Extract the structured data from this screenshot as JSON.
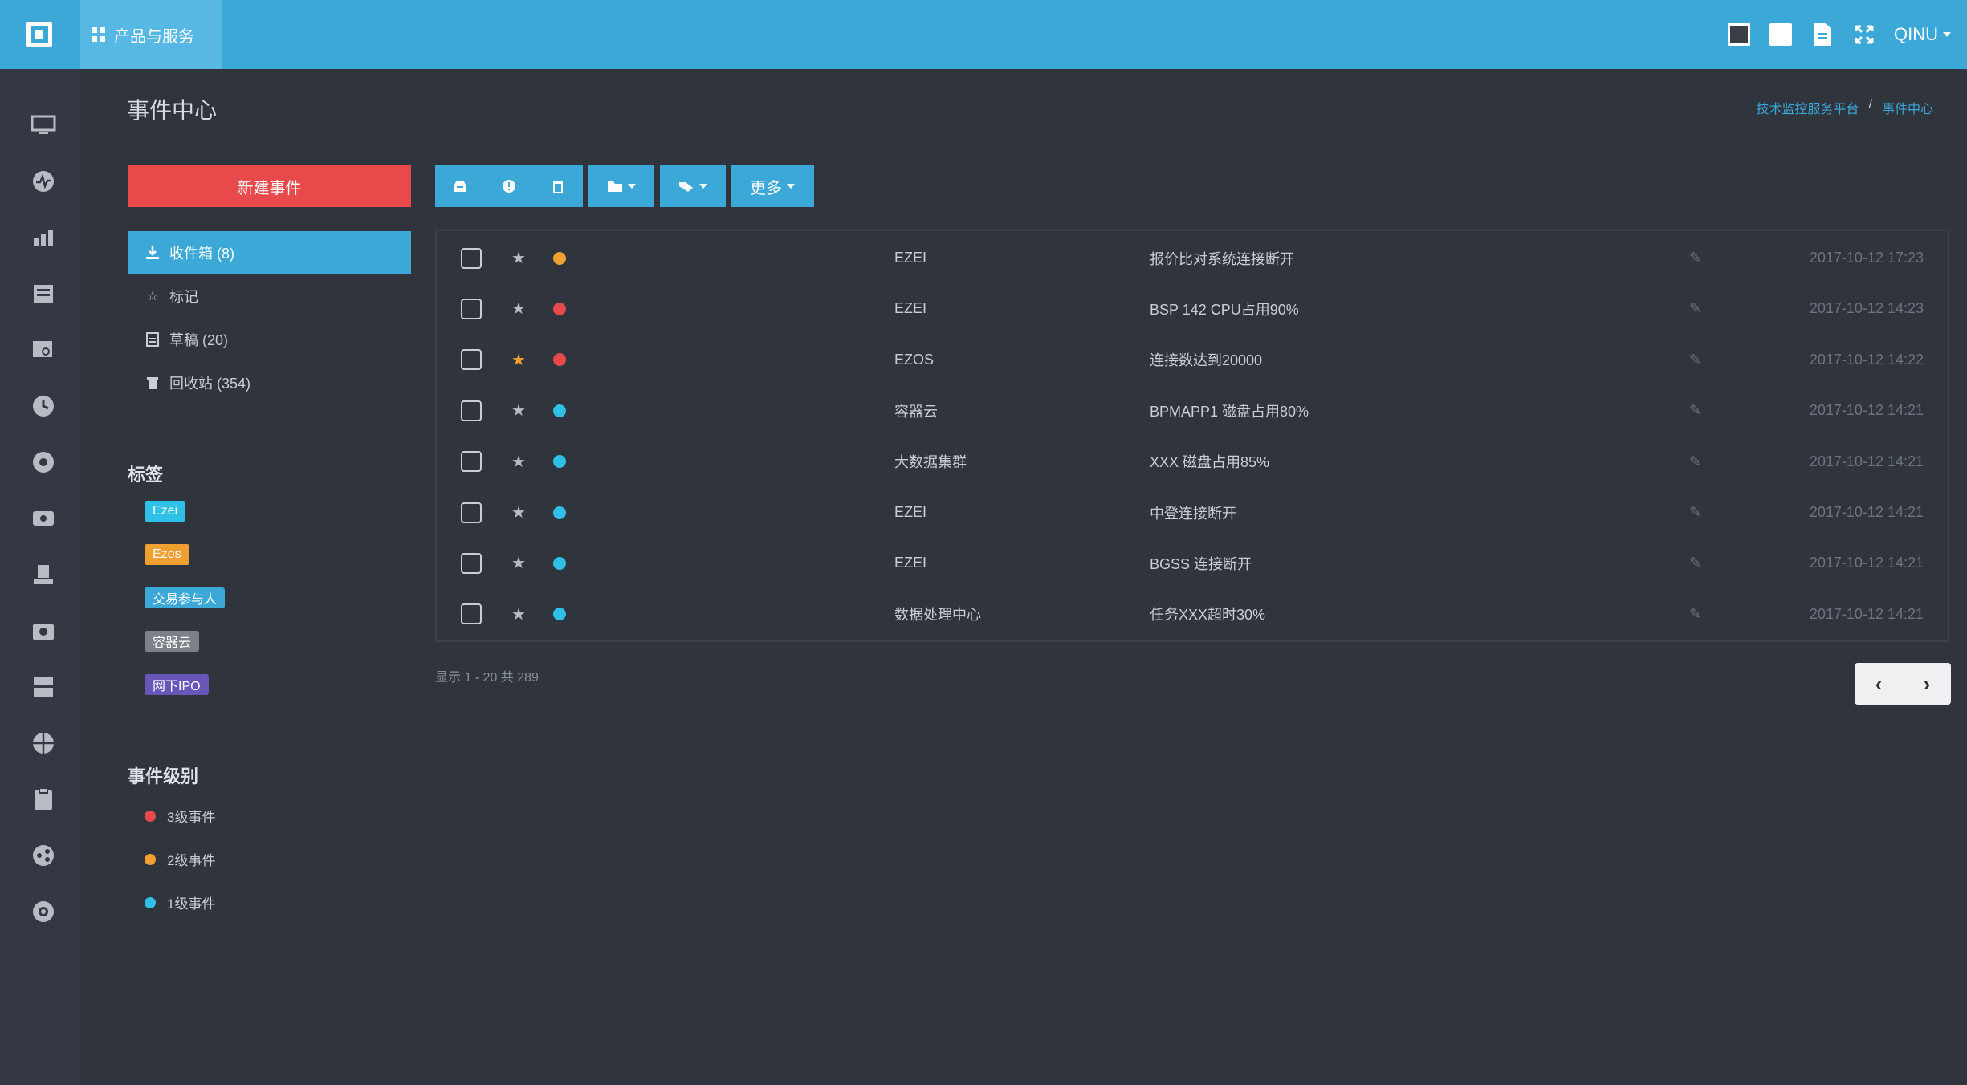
{
  "topbar": {
    "products_label": "产品与服务",
    "user_label": "QINU"
  },
  "page": {
    "title": "事件中心",
    "breadcrumb": [
      "技术监控服务平台",
      "事件中心"
    ]
  },
  "sidebar": {
    "new_event_label": "新建事件",
    "folders": [
      {
        "label": "收件箱 (8)",
        "icon": "inbox-icon",
        "active": true
      },
      {
        "label": "标记",
        "icon": "star-icon",
        "active": false
      },
      {
        "label": "草稿 (20)",
        "icon": "draft-icon",
        "active": false
      },
      {
        "label": "回收站 (354)",
        "icon": "trash-icon",
        "active": false
      }
    ],
    "tags_title": "标签",
    "tags": [
      {
        "label": "Ezei",
        "color": "#2ec0e6"
      },
      {
        "label": "Ezos",
        "color": "#f0a030"
      },
      {
        "label": "交易参与人",
        "color": "#3ba8d8"
      },
      {
        "label": "容器云",
        "color": "#7b8089"
      },
      {
        "label": "网下IPO",
        "color": "#6a55b8"
      }
    ],
    "levels_title": "事件级别",
    "levels": [
      {
        "label": "3级事件",
        "color": "#e8494b"
      },
      {
        "label": "2级事件",
        "color": "#f0a030"
      },
      {
        "label": "1级事件",
        "color": "#2ec0e6"
      }
    ]
  },
  "toolbar": {
    "more_label": "更多"
  },
  "events": [
    {
      "starred": false,
      "severity_color": "#f0a030",
      "source": "EZEI",
      "subject": "报价比对系统连接断开",
      "time": "2017-10-12 17:23"
    },
    {
      "starred": false,
      "severity_color": "#e8494b",
      "source": "EZEI",
      "subject": "BSP 142 CPU占用90%",
      "time": "2017-10-12 14:23"
    },
    {
      "starred": true,
      "severity_color": "#e8494b",
      "source": "EZOS",
      "subject": "连接数达到20000",
      "time": "2017-10-12 14:22"
    },
    {
      "starred": false,
      "severity_color": "#2ec0e6",
      "source": "容器云",
      "subject": "BPMAPP1 磁盘占用80%",
      "time": "2017-10-12 14:21"
    },
    {
      "starred": false,
      "severity_color": "#2ec0e6",
      "source": "大数据集群",
      "subject": "XXX 磁盘占用85%",
      "time": "2017-10-12 14:21"
    },
    {
      "starred": false,
      "severity_color": "#2ec0e6",
      "source": "EZEI",
      "subject": "中登连接断开",
      "time": "2017-10-12 14:21"
    },
    {
      "starred": false,
      "severity_color": "#2ec0e6",
      "source": "EZEI",
      "subject": "BGSS 连接断开",
      "time": "2017-10-12 14:21"
    },
    {
      "starred": false,
      "severity_color": "#2ec0e6",
      "source": "数据处理中心",
      "subject": "任务XXX超时30%",
      "time": "2017-10-12 14:21"
    }
  ],
  "pagination": {
    "info": "显示 1 - 20 共 289"
  },
  "colors": {
    "accent": "#3ba8d8",
    "danger": "#e8494b",
    "warning": "#f0a030",
    "info": "#2ec0e6"
  }
}
